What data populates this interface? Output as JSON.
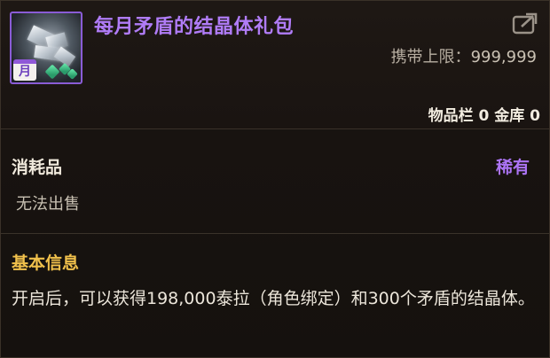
{
  "item": {
    "title": "每月矛盾的结晶体礼包",
    "icon_name": "crystal-pack-icon",
    "month_badge": "月",
    "frame_color": "#8a5cd6"
  },
  "header": {
    "carry_limit_label": "携带上限：",
    "carry_limit_value": "999,999",
    "inventory_text": "物品栏 0 金库 0"
  },
  "type_section": {
    "category": "消耗品",
    "rarity": "稀有",
    "rarity_color": "#ac74f5",
    "sell_status": "无法出售"
  },
  "info_section": {
    "title": "基本信息",
    "description": "开启后，可以获得198,000泰拉（角色绑定）和300个矛盾的结晶体。"
  }
}
